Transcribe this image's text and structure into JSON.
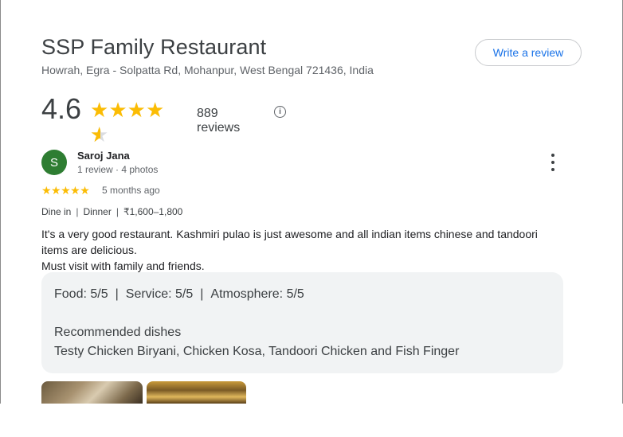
{
  "place": {
    "name": "SSP Family Restaurant",
    "address": "Howrah, Egra - Solpatta Rd, Mohanpur, West Bengal 721436, India",
    "rating": "4.6",
    "rating_value": 4.6,
    "review_count": "889 reviews",
    "write_review_label": "Write a review"
  },
  "review": {
    "avatar_letter": "S",
    "avatar_color": "#2e7d32",
    "reviewer": "Saroj Jana",
    "reviewer_meta": "1 review · 4 photos",
    "stars": "★★★★★",
    "star_count": 5,
    "time": "5 months ago",
    "visit": {
      "type": "Dine in",
      "meal": "Dinner",
      "price": "₹1,600–1,800",
      "separator": "|"
    },
    "text_line1": "It's a very good restaurant. Kashmiri pulao is just awesome and all indian items chinese and tandoori items are delicious.",
    "text_line2": "Must visit with family and friends.",
    "scores": {
      "food": "Food: 5/5",
      "service": "Service: 5/5",
      "atmosphere": "Atmosphere: 5/5",
      "separator": "|"
    },
    "recommended_title": "Recommended dishes",
    "recommended_dishes": "Testy Chicken Biryani, Chicken Kosa, Tandoori Chicken and Fish Finger"
  },
  "colors": {
    "accent": "#1a73e8",
    "star": "#fbbc04"
  },
  "icons": {
    "info": "info-icon",
    "more": "more-vert-icon"
  }
}
